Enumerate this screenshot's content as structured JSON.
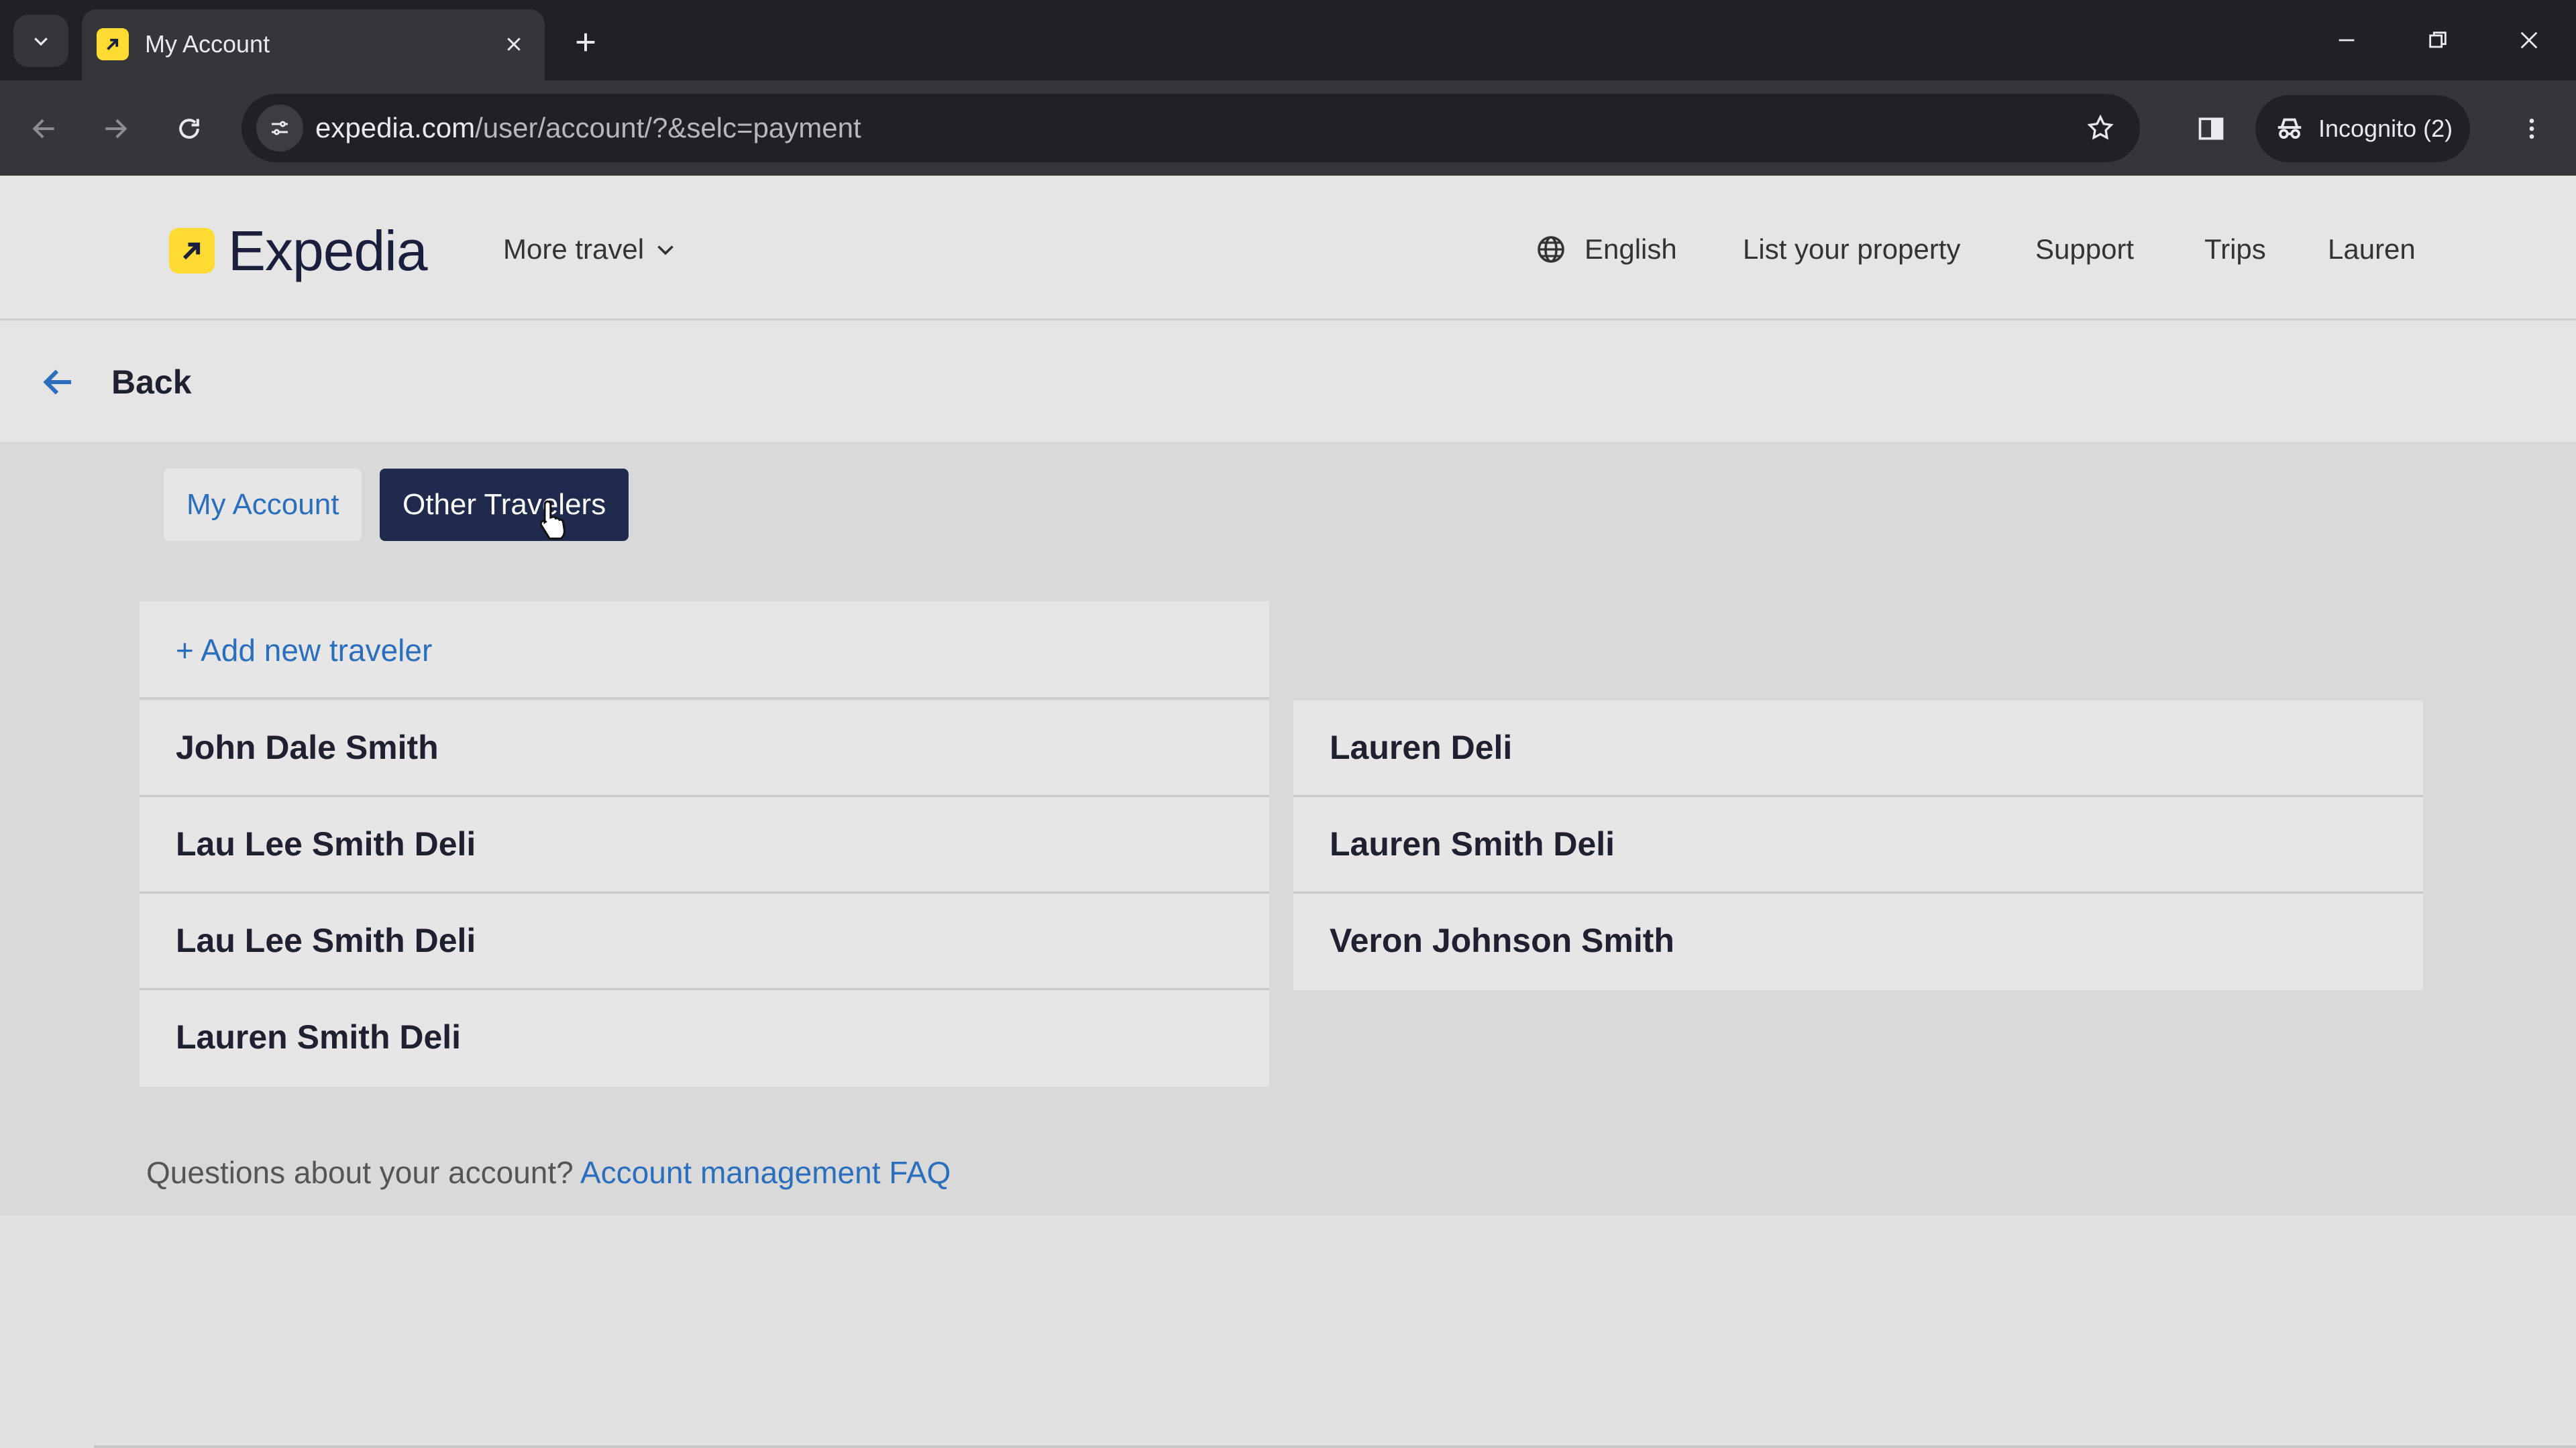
{
  "browser": {
    "tab_title": "My Account",
    "url_host": "expedia.com",
    "url_path": "/user/account/?&selc=payment",
    "incognito_label": "Incognito (2)",
    "icons": [
      "tab-search-icon",
      "expedia-favicon",
      "close-icon",
      "plus-icon",
      "minimize-icon",
      "restore-icon",
      "window-close-icon",
      "back-icon",
      "forward-icon",
      "reload-icon",
      "site-info-icon",
      "star-icon",
      "side-panel-icon",
      "incognito-icon",
      "kebab-menu-icon"
    ]
  },
  "header": {
    "logo_text": "Expedia",
    "more_travel": "More travel",
    "language": "English",
    "list_property": "List your property",
    "support": "Support",
    "trips": "Trips",
    "user": "Lauren"
  },
  "back": {
    "label": "Back"
  },
  "tabs": [
    {
      "label": "My Account",
      "active": false
    },
    {
      "label": "Other Travelers",
      "active": true
    }
  ],
  "add_traveler": "+ Add new traveler",
  "travelers_left": [
    "John Dale Smith",
    "Lau Lee Smith Deli",
    "Lau Lee Smith Deli",
    "Lauren Smith Deli"
  ],
  "travelers_right": [
    "Lauren Deli",
    "Lauren Smith Deli",
    "Veron Johnson Smith"
  ],
  "footer": {
    "question": "Questions about your account?",
    "faq_link": "Account management FAQ"
  },
  "colors": {
    "accent_link": "#2a6ebd",
    "active_tab": "#1f2a4d",
    "logo_yellow": "#fddb32"
  }
}
